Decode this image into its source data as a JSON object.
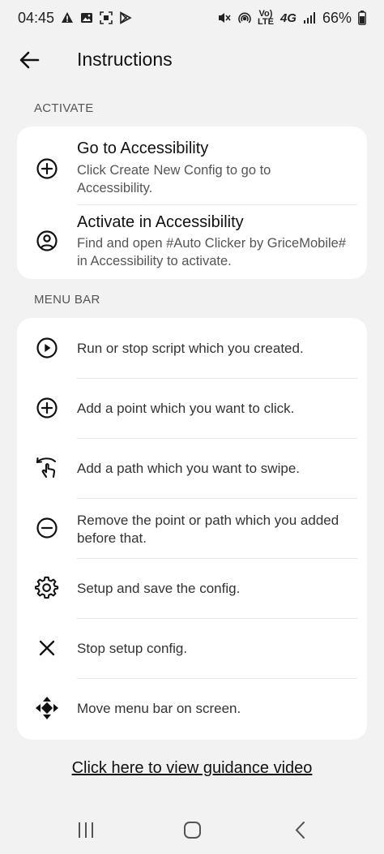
{
  "status_bar": {
    "time": "04:45",
    "volte_top": "Vo)",
    "volte_bottom": "LTE",
    "network": "4G",
    "battery": "66%"
  },
  "header": {
    "title": "Instructions"
  },
  "activate_section": {
    "label": "ACTIVATE",
    "items": [
      {
        "title": "Go to Accessibility",
        "description": "Click Create New Config to go to Accessibility.",
        "icon": "plus-circle-icon"
      },
      {
        "title": "Activate in Accessibility",
        "description": "Find and open #Auto Clicker by GriceMobile# in Accessibility to activate.",
        "icon": "account-circle-icon"
      }
    ]
  },
  "menu_section": {
    "label": "MENU BAR",
    "items": [
      {
        "text": "Run or stop script which you created.",
        "icon": "play-circle-icon"
      },
      {
        "text": "Add a point which you want to click.",
        "icon": "plus-circle-icon"
      },
      {
        "text": "Add a path which you want to swipe.",
        "icon": "swipe-gesture-icon"
      },
      {
        "text": "Remove the point or path which you added before that.",
        "icon": "minus-circle-icon"
      },
      {
        "text": "Setup and save the config.",
        "icon": "gear-icon"
      },
      {
        "text": "Stop setup config.",
        "icon": "close-icon"
      },
      {
        "text": "Move menu bar on screen.",
        "icon": "move-arrows-icon"
      }
    ]
  },
  "guidance_link": "Click here to view guidance video"
}
